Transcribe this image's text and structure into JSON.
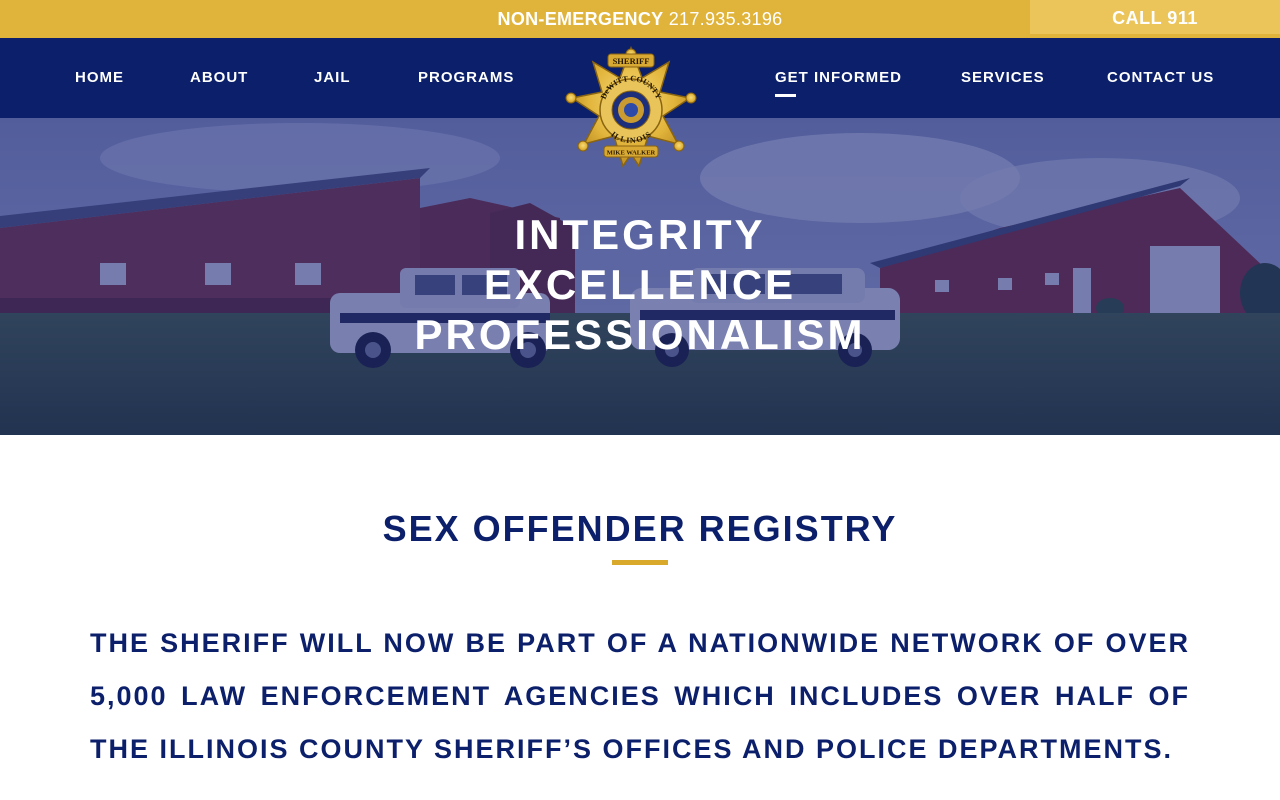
{
  "topbar": {
    "non_emergency_label": "NON-EMERGENCY",
    "non_emergency_phone": "217.935.3196",
    "call_label": "CALL 911"
  },
  "nav": {
    "left": [
      {
        "label": "HOME"
      },
      {
        "label": "ABOUT"
      },
      {
        "label": "JAIL"
      },
      {
        "label": "PROGRAMS"
      }
    ],
    "right": [
      {
        "label": "GET INFORMED",
        "active": true
      },
      {
        "label": "SERVICES"
      },
      {
        "label": "CONTACT US"
      }
    ]
  },
  "logo": {
    "top_text": "SHERIFF",
    "county_text": "DeWITT COUNTY",
    "state_text": "ILLINOIS",
    "name_text": "MIKE WALKER",
    "icon": "sheriff-star-badge"
  },
  "hero": {
    "lines": [
      "INTEGRITY",
      "EXCELLENCE",
      "PROFESSIONALISM"
    ]
  },
  "content": {
    "title": "SEX OFFENDER REGISTRY",
    "paragraph": "THE SHERIFF WILL NOW BE PART OF A NATIONWIDE NETWORK OF OVER 5,000 LAW ENFORCEMENT AGENCIES WHICH INCLUDES OVER HALF OF THE ILLINOIS COUNTY SHERIFF’S OFFICES AND POLICE DEPARTMENTS."
  },
  "colors": {
    "navy": "#0b1f6b",
    "gold": "#e0b33a",
    "gold_light": "#ebc45a",
    "underline_gold": "#d9a92c",
    "white": "#ffffff"
  }
}
